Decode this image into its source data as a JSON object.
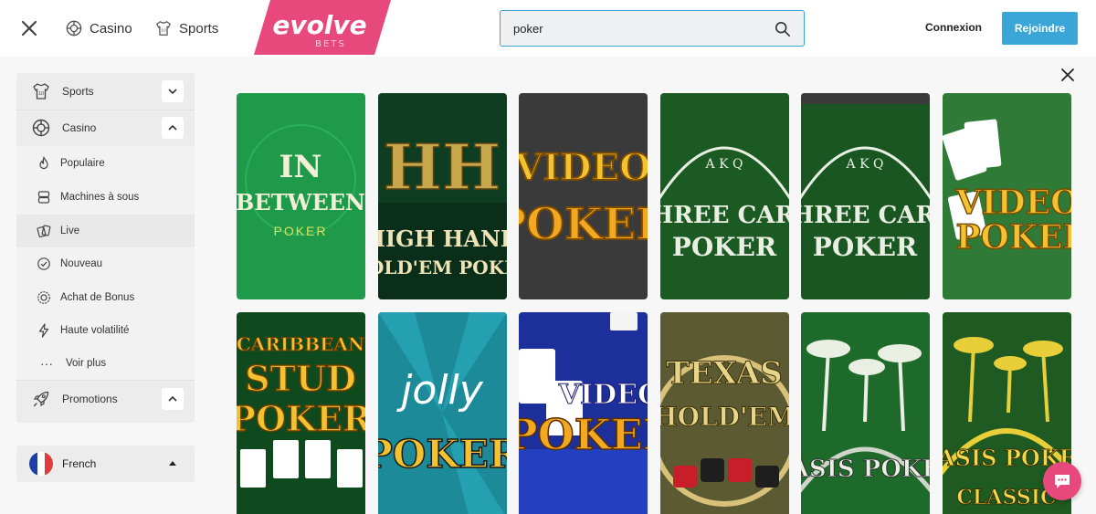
{
  "header": {
    "casino_label": "Casino",
    "sports_label": "Sports",
    "logo_text": "evolve",
    "logo_sub": "BETS",
    "search_value": "poker",
    "login_label": "Connexion",
    "join_label": "Rejoindre",
    "accent_color": "#3aa6d8",
    "brand_color": "#e8497c"
  },
  "sidebar": {
    "sports": "Sports",
    "casino": "Casino",
    "sub_items": [
      "Populaire",
      "Machines à sous",
      "Live",
      "Nouveau",
      "Achat de Bonus",
      "Haute volatilité",
      "Voir plus"
    ],
    "promotions": "Promotions"
  },
  "language": {
    "label": "French"
  },
  "games": [
    {
      "line1": "IN",
      "line2": "BETWEEN",
      "line3": "POKER"
    },
    {
      "line1": "HH",
      "line2": "HIGH HAND",
      "line3": "HOLD'EM POKER"
    },
    {
      "line1": "VIDEO",
      "line2": "POKER",
      "line3": ""
    },
    {
      "line1": "A K Q",
      "line2": "THREE CARD",
      "line3": "POKER"
    },
    {
      "line1": "A K Q",
      "line2": "THREE CARD",
      "line3": "POKER"
    },
    {
      "line1": "VIDEO",
      "line2": "POKER",
      "line3": ""
    },
    {
      "line1": "CARIBBEAN",
      "line2": "STUD",
      "line3": "POKER"
    },
    {
      "line1": "jolly",
      "line2": "POKER",
      "line3": ""
    },
    {
      "line1": "VIDEO",
      "line2": "POKER",
      "line3": ""
    },
    {
      "line1": "TEXAS",
      "line2": "HOLD'EM",
      "line3": ""
    },
    {
      "line1": "OASIS POKER",
      "line2": "",
      "line3": ""
    },
    {
      "line1": "OASIS POKER",
      "line2": "CLASSIC",
      "line3": ""
    }
  ]
}
